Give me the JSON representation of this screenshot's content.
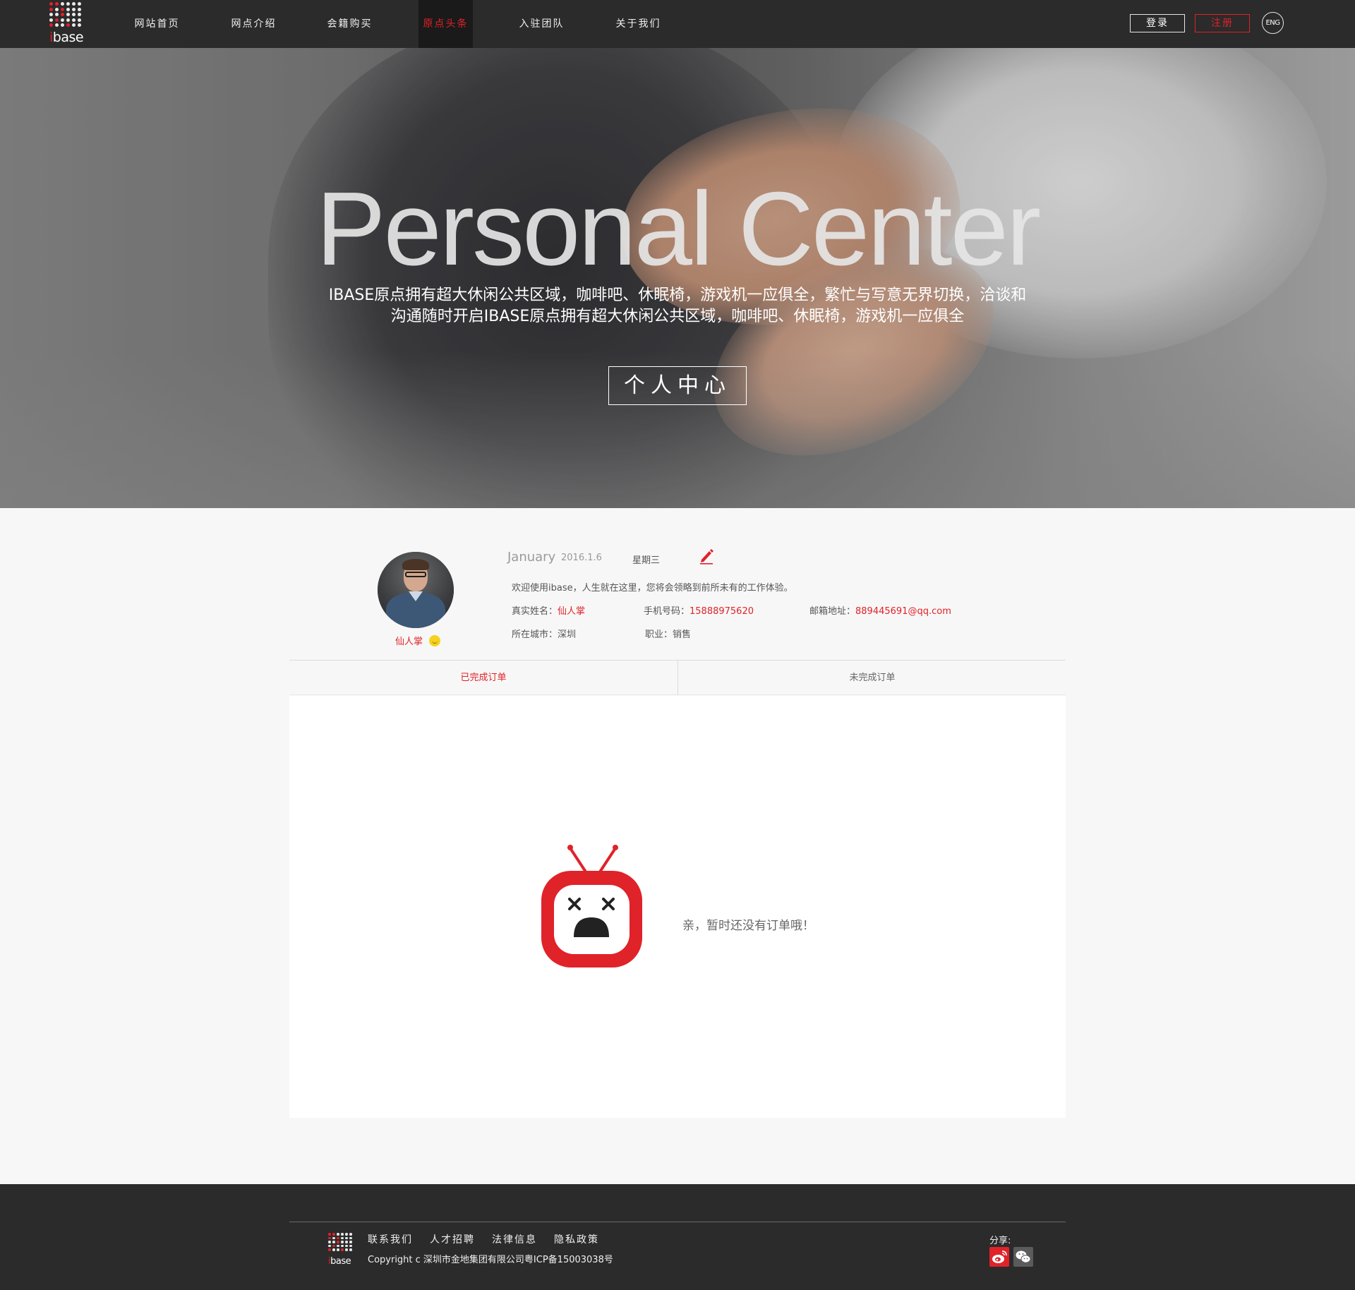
{
  "header": {
    "logo_text": "ibase",
    "nav": [
      {
        "label": "网站首页",
        "active": false
      },
      {
        "label": "网点介绍",
        "active": false
      },
      {
        "label": "会籍购买",
        "active": false
      },
      {
        "label": "原点头条",
        "active": true
      },
      {
        "label": "入驻团队",
        "active": false
      },
      {
        "label": "关于我们",
        "active": false
      }
    ],
    "login_label": "登录",
    "register_label": "注册",
    "lang_label": "ENG"
  },
  "hero": {
    "title": "Personal Center",
    "description_line1": "IBASE原点拥有超大休闲公共区域，咖啡吧、休眠椅，游戏机一应俱全，繁忙与写意无界切换，洽谈和",
    "description_line2": "沟通随时开启IBASE原点拥有超大休闲公共区域，咖啡吧、休眠椅，游戏机一应俱全",
    "button_label": "个人中心"
  },
  "profile": {
    "name": "仙人掌",
    "date_month": "January",
    "date_value": "2016.1.6",
    "weekday": "星期三",
    "welcome": "欢迎使用ibase，人生就在这里，您将会领略到前所未有的工作体验。",
    "real_name_label": "真实姓名：",
    "real_name": "仙人掌",
    "phone_label": "手机号码：",
    "phone": "15888975620",
    "email_label": "邮箱地址：",
    "email": "889445691@qq.com",
    "city_label": "所在城市：",
    "city": "深圳",
    "job_label": "职业：",
    "job": "销售"
  },
  "tabs": [
    {
      "label": "已完成订单",
      "active": true
    },
    {
      "label": "未完成订单",
      "active": false
    }
  ],
  "empty_state": {
    "message": "亲，暂时还没有订单哦！",
    "icon": "sad-tv-icon"
  },
  "footer": {
    "logo_text": "ibase",
    "links": [
      "联系我们",
      "人才招聘",
      "法律信息",
      "隐私政策"
    ],
    "copyright": "Copyright c 深圳市金地集团有限公司粤ICP备15003038号",
    "share_label": "分享:",
    "share_icons": [
      "weibo-icon",
      "wechat-icon"
    ]
  },
  "colors": {
    "accent": "#e02229",
    "header_bg": "#2b2b2b",
    "page_bg": "#f7f7f7"
  }
}
